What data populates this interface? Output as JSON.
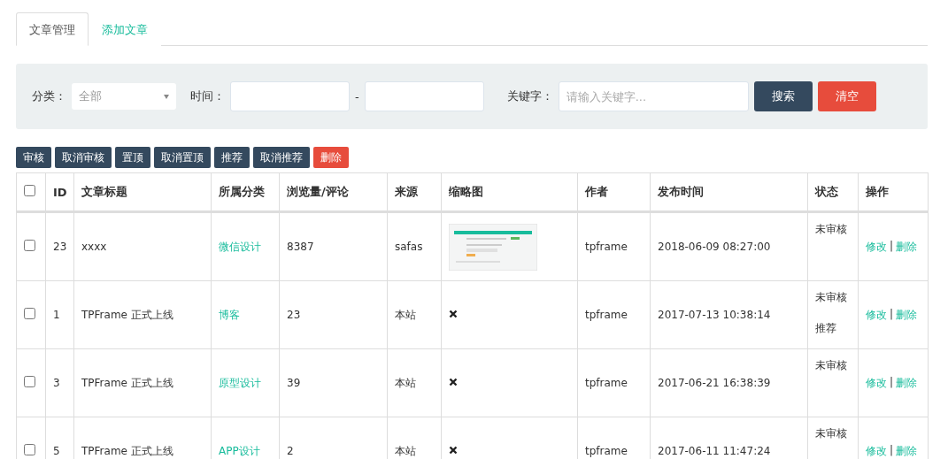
{
  "tabs": [
    {
      "label": "文章管理",
      "selected": true
    },
    {
      "label": "添加文章",
      "selected": false
    }
  ],
  "filter": {
    "category_label": "分类：",
    "category_value": "全部",
    "time_label": "时间：",
    "time_separator": "-",
    "keyword_label": "关键字：",
    "keyword_placeholder": "请输入关键字...",
    "search_button": "搜索",
    "clear_button": "清空"
  },
  "actions": [
    {
      "label": "审核",
      "kind": "normal"
    },
    {
      "label": "取消审核",
      "kind": "normal"
    },
    {
      "label": "置顶",
      "kind": "normal"
    },
    {
      "label": "取消置顶",
      "kind": "normal"
    },
    {
      "label": "推荐",
      "kind": "normal"
    },
    {
      "label": "取消推荐",
      "kind": "normal"
    },
    {
      "label": "删除",
      "kind": "danger"
    }
  ],
  "table": {
    "select_all_checked": false,
    "columns": [
      "ID",
      "文章标题",
      "所属分类",
      "浏览量/评论",
      "来源",
      "缩略图",
      "作者",
      "发布时间",
      "状态",
      "操作"
    ],
    "rows": [
      {
        "checked": false,
        "id": "23",
        "title": "xxxx",
        "category": "微信设计",
        "views": "8387",
        "source": "safas",
        "has_thumbnail": true,
        "author": "tpframe",
        "published": "2018-06-09 08:27:00",
        "status": [
          "未审核"
        ],
        "edit": "修改",
        "separator": "|",
        "delete": "删除"
      },
      {
        "checked": false,
        "id": "1",
        "title": "TPFrame 正式上线",
        "category": "博客",
        "views": "23",
        "source": "本站",
        "has_thumbnail": false,
        "author": "tpframe",
        "published": "2017-07-13 10:38:14",
        "status": [
          "未审核",
          "推荐"
        ],
        "edit": "修改",
        "separator": "|",
        "delete": "删除"
      },
      {
        "checked": false,
        "id": "3",
        "title": "TPFrame 正式上线",
        "category": "原型设计",
        "views": "39",
        "source": "本站",
        "has_thumbnail": false,
        "author": "tpframe",
        "published": "2017-06-21 16:38:39",
        "status": [
          "未审核"
        ],
        "edit": "修改",
        "separator": "|",
        "delete": "删除"
      },
      {
        "checked": false,
        "id": "5",
        "title": "TPFrame 正式上线",
        "category": "APP设计",
        "views": "2",
        "source": "本站",
        "has_thumbnail": false,
        "author": "tpframe",
        "published": "2017-06-11 11:47:24",
        "status": [
          "未审核"
        ],
        "edit": "修改",
        "separator": "|",
        "delete": "删除"
      }
    ]
  }
}
